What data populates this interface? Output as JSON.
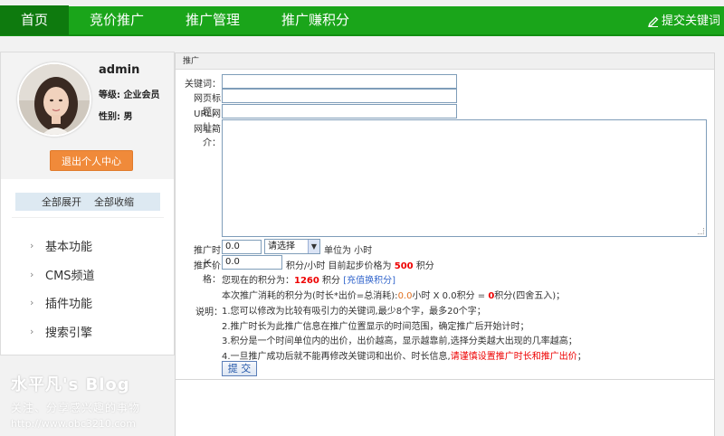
{
  "nav": {
    "items": [
      "首页",
      "竞价推广",
      "推广管理",
      "推广赚积分"
    ],
    "right_label": "提交关键词"
  },
  "profile": {
    "username": "admin",
    "level": "等级: 企业会员",
    "gender": "性别: 男",
    "logout_label": "退出个人中心"
  },
  "sidebar": {
    "expand_all": "全部展开",
    "collapse_all": "全部收缩",
    "menu": [
      "基本功能",
      "CMS频道",
      "插件功能",
      "搜索引擎"
    ]
  },
  "panel": {
    "title": "推广",
    "keyword_label": "关键词：",
    "page_title_label": "网页标题：",
    "url_label": "URL网址：",
    "desc_label": "网址简介：",
    "duration_label": "推广时长：",
    "duration_value": "0.0",
    "select_value": "请选择",
    "unit_text": "单位为 小时",
    "price_label": "推广价格：",
    "price_value": "0.0",
    "price_unit_a": "积分/小时 目前起步价格为",
    "price_min": "500",
    "price_unit_b": "积分",
    "points_a": "您现在的积分为：",
    "points_value": "1260",
    "points_b": "积分",
    "recharge_link": "[充值换积分]",
    "cost_a": "本次推广消耗的积分为(时长*出价=总消耗):",
    "cost_hours": "0.0",
    "cost_b": "小时 X 0.0积分 =",
    "cost_total": "0",
    "cost_c": "积分(四舍五入)；",
    "note_label": "说明：",
    "note1": "1.您可以修改为比较有吸引力的关键词,最少8个字，最多20个字；",
    "note2": "2.推广时长为此推广信息在推广位置显示的时间范围，确定推广后开始计时；",
    "note3": "3.积分是一个时间单位内的出价，出价越高，显示越靠前,选择分类越大出现的几率越高；",
    "note4_a": "4.一旦推广成功后就不能再修改关键词和出价、时长信息,",
    "note4_b": "请谨慎设置推广时长和推广出价",
    "note4_c": "；",
    "submit_label": "提 交"
  },
  "watermark": {
    "title": "水平凡's Blog",
    "subtitle": "关注、分享感兴趣的事物",
    "url": "http://www.obc3210.com"
  },
  "colors": {
    "nav_green": "#1aa51a",
    "nav_active": "#0e7a0e",
    "accent_orange": "#f08a3a",
    "highlight_red": "#e00000",
    "link_blue": "#3366cc"
  }
}
